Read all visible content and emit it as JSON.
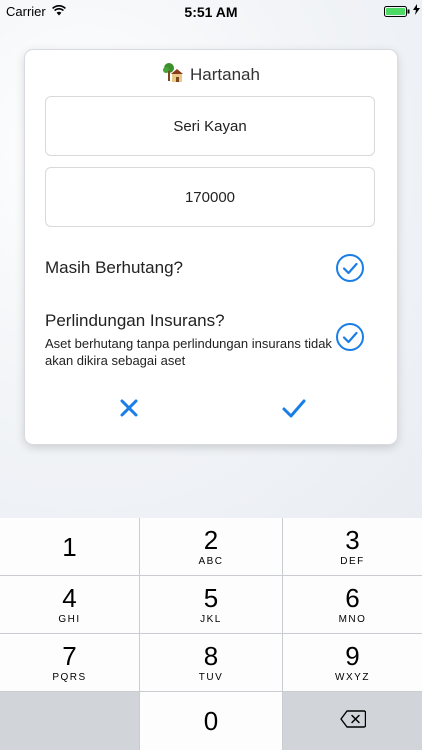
{
  "status_bar": {
    "carrier": "Carrier",
    "time": "5:51 AM"
  },
  "dialog": {
    "title": "Hartanah",
    "name_value": "Seri Kayan",
    "amount_value": "170000",
    "debt_question": "Masih Berhutang?",
    "debt_checked": true,
    "insurance_question": "Perlindungan Insurans?",
    "insurance_note": "Aset berhutang tanpa perlindungan insurans tidak akan dikira sebagai aset",
    "insurance_checked": true
  },
  "keypad": {
    "keys": [
      {
        "num": "1",
        "letters": ""
      },
      {
        "num": "2",
        "letters": "ABC"
      },
      {
        "num": "3",
        "letters": "DEF"
      },
      {
        "num": "4",
        "letters": "GHI"
      },
      {
        "num": "5",
        "letters": "JKL"
      },
      {
        "num": "6",
        "letters": "MNO"
      },
      {
        "num": "7",
        "letters": "PQRS"
      },
      {
        "num": "8",
        "letters": "TUV"
      },
      {
        "num": "9",
        "letters": "WXYZ"
      },
      {
        "num": "0",
        "letters": ""
      }
    ]
  },
  "colors": {
    "accent": "#1a7ee6"
  },
  "icons": [
    "wifi-icon",
    "battery-icon",
    "house-tree-icon",
    "check-circle-icon",
    "close-icon",
    "checkmark-icon",
    "backspace-icon"
  ]
}
